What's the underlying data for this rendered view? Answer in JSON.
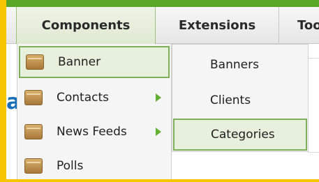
{
  "menubar": {
    "items": [
      "Components",
      "Extensions",
      "Too"
    ]
  },
  "background": {
    "partial_letter": "a"
  },
  "dropdown": {
    "items": [
      {
        "label": "Banner",
        "has_submenu": false,
        "highlighted": true
      },
      {
        "label": "Contacts",
        "has_submenu": true,
        "highlighted": false
      },
      {
        "label": "News Feeds",
        "has_submenu": true,
        "highlighted": false
      },
      {
        "label": "Polls",
        "has_submenu": false,
        "highlighted": false
      }
    ]
  },
  "submenu": {
    "items": [
      {
        "label": "Banners",
        "highlighted": false
      },
      {
        "label": "Clients",
        "highlighted": false
      },
      {
        "label": "Categories",
        "highlighted": true
      }
    ]
  },
  "colors": {
    "frame_yellow": "#f6c700",
    "frame_green": "#5aa728",
    "hover_bg": "#e7f0dd",
    "hover_border": "#7fae5a",
    "arrow_green": "#63b032",
    "link_blue": "#1b6fb6"
  },
  "icons": {
    "menu_item_icon": "folder-box-icon",
    "submenu_arrow": "right-arrow-icon"
  }
}
